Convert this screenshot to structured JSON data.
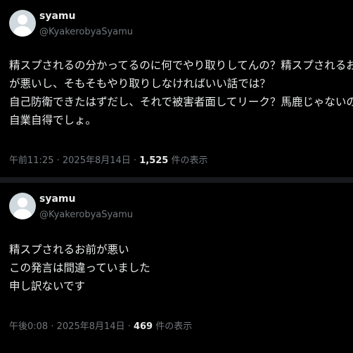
{
  "posts": [
    {
      "author": {
        "name": "syamu",
        "handle": "@KyakerobyaSyamu"
      },
      "text_lines": [
        "精スプされるの分かってるのに何でやり取りしてんの？精スプされるお前",
        "が悪いし、そもそもやり取りしなければいい話では？",
        "自己防衛できたはずだし、それで被害者面してリーク？馬鹿じゃないの？",
        "自業自得でしょ。"
      ],
      "time": "午前11:25",
      "date": "2025年8月14日",
      "separator": "·",
      "views": "1,525",
      "views_suffix": "件の表示"
    },
    {
      "author": {
        "name": "syamu",
        "handle": "@KyakerobyaSyamu"
      },
      "text_lines": [
        "精スプされるお前が悪い",
        "この発言は間違っていました",
        "申し訳ないです"
      ],
      "time": "午後0:08",
      "date": "2025年8月14日",
      "separator": "·",
      "views": "469",
      "views_suffix": "件の表示"
    }
  ],
  "colors": {
    "background": "#000000",
    "text": "#e7e9ea",
    "secondary": "#71767b",
    "separator": "#16181c"
  }
}
